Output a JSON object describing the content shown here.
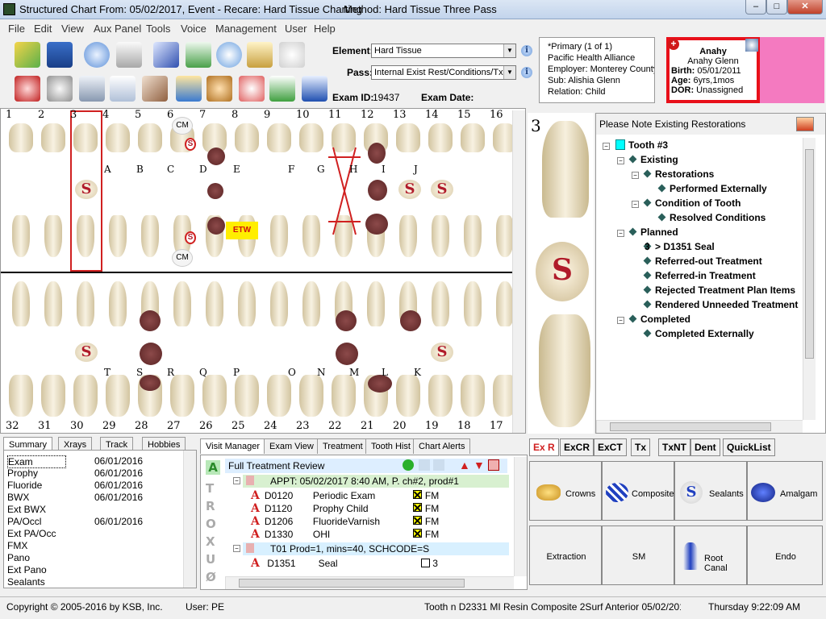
{
  "window": {
    "title": "Structured Chart From: 05/02/2017, Event - Recare: Hard Tissue Charting",
    "method": "Method: Hard Tissue Three Pass"
  },
  "menu": [
    "File",
    "Edit",
    "View",
    "Aux Panel",
    "Tools",
    "Voice",
    "Management",
    "User",
    "Help"
  ],
  "element_form": {
    "element_label": "Element:",
    "element_value": "Hard Tissue",
    "pass_label": "Pass:",
    "pass_value": "Internal Exist Rest/Conditions/Tx",
    "exam_id_label": "Exam ID:",
    "exam_id": "19437",
    "exam_date_label": "Exam Date:"
  },
  "insurance": {
    "primary": "*Primary (1 of 1)",
    "carrier": "Pacific Health Alliance",
    "employer": "Employer: Monterey County",
    "sub": "Sub: Alishia Glenn",
    "relation": "Relation: Child"
  },
  "patient": {
    "first": "Anahy",
    "full": "Anahy Glenn",
    "birth_label": "Birth:",
    "birth": "05/01/2011",
    "age_label": "Age:",
    "age": "6yrs,1mos",
    "dor_label": "DOR:",
    "dor": "Unassigned"
  },
  "chart": {
    "upper_numbers": [
      "1",
      "2",
      "3",
      "4",
      "5",
      "6",
      "7",
      "8",
      "9",
      "10",
      "11",
      "12",
      "13",
      "14",
      "15",
      "16"
    ],
    "lower_numbers": [
      "32",
      "31",
      "30",
      "29",
      "28",
      "27",
      "26",
      "25",
      "24",
      "23",
      "22",
      "21",
      "20",
      "19",
      "18",
      "17"
    ],
    "upper_primary": [
      "A",
      "B",
      "C",
      "D",
      "E",
      "F",
      "G",
      "H",
      "I",
      "J"
    ],
    "lower_primary": [
      "T",
      "S",
      "R",
      "Q",
      "P",
      "O",
      "N",
      "M",
      "L",
      "K"
    ],
    "marks": {
      "s": "S",
      "cm": "CM",
      "etw": "ETW"
    }
  },
  "tooth_preview": {
    "number": "3",
    "s": "S"
  },
  "notes": {
    "header": "Please Note Existing Restorations",
    "tree": [
      {
        "label": "Tooth #3",
        "bold": true
      },
      {
        "label": "Existing",
        "bold": true
      },
      {
        "label": "Restorations",
        "bold": true
      },
      {
        "label": "Performed Externally",
        "bold": true
      },
      {
        "label": "Condition of Tooth",
        "bold": true
      },
      {
        "label": "Resolved Conditions",
        "bold": true
      },
      {
        "label": "Planned",
        "bold": true
      },
      {
        "label": "> D1351 Seal",
        "bold": true
      },
      {
        "label": "Referred-out Treatment",
        "bold": true
      },
      {
        "label": "Referred-in Treatment",
        "bold": true
      },
      {
        "label": "Rejected Treatment Plan Items",
        "bold": true
      },
      {
        "label": "Rendered Unneeded Treatment",
        "bold": true
      },
      {
        "label": "Completed",
        "bold": true
      },
      {
        "label": "Completed Externally",
        "bold": true
      }
    ],
    "planned_count": "3"
  },
  "left_tabs": [
    "Summary",
    "Xrays",
    "Track",
    "Hobbies"
  ],
  "summary": [
    {
      "name": "Exam",
      "date": "06/01/2016"
    },
    {
      "name": "Prophy",
      "date": "06/01/2016"
    },
    {
      "name": "Fluoride",
      "date": "06/01/2016"
    },
    {
      "name": "BWX",
      "date": "06/01/2016"
    },
    {
      "name": "Ext BWX",
      "date": ""
    },
    {
      "name": "PA/Occl",
      "date": "06/01/2016"
    },
    {
      "name": "Ext PA/Occ",
      "date": ""
    },
    {
      "name": "FMX",
      "date": ""
    },
    {
      "name": "Pano",
      "date": ""
    },
    {
      "name": "Ext Pano",
      "date": ""
    },
    {
      "name": "Sealants",
      "date": ""
    }
  ],
  "visit_tabs": [
    "Visit Manager",
    "Exam View",
    "Treatment",
    "Tooth Hist",
    "Chart Alerts"
  ],
  "visit": {
    "vertical_letters": [
      "A",
      "T",
      "R",
      "O",
      "X",
      "U",
      "Ø"
    ],
    "header": "Full Treatment Review",
    "appt": "APPT: 05/02/2017 8:40 AM, P. ch#2, prod#1",
    "procs": [
      {
        "code": "D0120",
        "desc": "Periodic Exam",
        "tooth": "FM"
      },
      {
        "code": "D1120",
        "desc": "Prophy Child",
        "tooth": "FM"
      },
      {
        "code": "D1206",
        "desc": "FluorideVarnish",
        "tooth": "FM"
      },
      {
        "code": "D1330",
        "desc": "OHI",
        "tooth": "FM"
      }
    ],
    "t01": "T01 Prod=1, mins=40, SCHCODE=S",
    "seal": {
      "code": "D1351",
      "desc": "Seal",
      "tooth": "3"
    }
  },
  "quick_tabs": [
    "Ex R",
    "ExCR",
    "ExCT",
    "Tx",
    "TxNT",
    "Dent",
    "QuickList"
  ],
  "quick_buttons": [
    "Crowns",
    "Composite",
    "Sealants",
    "Amalgam",
    "Extraction",
    "SM",
    "Root Canal",
    "Endo"
  ],
  "status": {
    "copyright": "Copyright © 2005-2016 by KSB, Inc.",
    "user": "User: PE",
    "tooth": "Tooth n D2331 MI Resin Composite 2Surf Anterior 05/02/201",
    "time": "Thursday 9:22:09 AM"
  },
  "colors": {
    "alert_red": "#e8101a",
    "pink": "#f47ac0",
    "decay": "#6b3030",
    "s_red": "#b01b2a"
  }
}
